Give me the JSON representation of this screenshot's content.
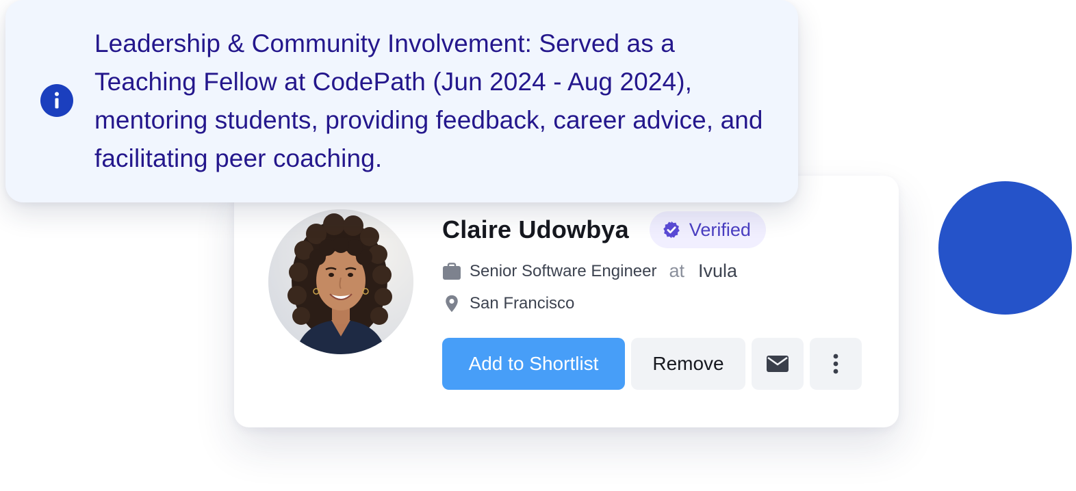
{
  "banner": {
    "icon": "info-icon",
    "text": "Leadership & Community Involvement: Served as a Teaching Fellow at CodePath (Jun 2024 - Aug 2024), mentoring students, providing feedback, career advice, and facilitating peer coaching."
  },
  "profile": {
    "name": "Claire Udowbya",
    "verified_label": "Verified",
    "job_title": "Senior Software Engineer",
    "at_word": "at",
    "company": "Ivula",
    "location": "San Francisco",
    "icons": {
      "job": "briefcase-icon",
      "location": "location-pin-icon",
      "verified": "verified-badge-icon"
    }
  },
  "actions": {
    "primary_label": "Add to Shortlist",
    "secondary_label": "Remove",
    "mail_icon": "mail-icon",
    "more_icon": "more-vertical-icon"
  },
  "colors": {
    "primary_button": "#479ef8",
    "banner_background": "#f1f6fe",
    "banner_text": "#24178c",
    "info_icon": "#1b3fbe",
    "verified_badge": "#5b4bd6",
    "decorative_circle": "#2553c9"
  }
}
